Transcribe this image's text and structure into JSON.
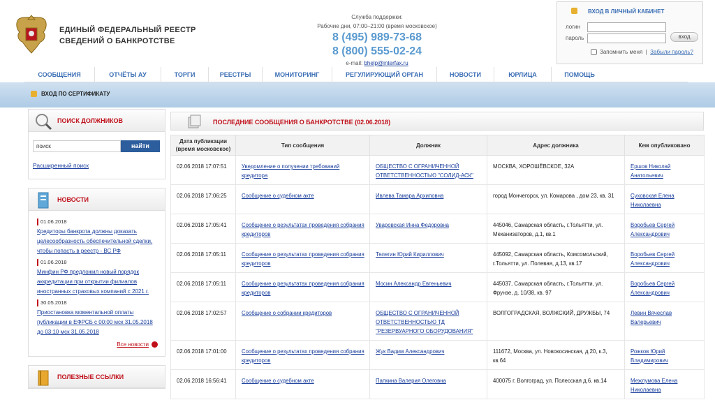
{
  "header": {
    "title_line1": "ЕДИНЫЙ ФЕДЕРАЛЬНЫЙ РЕЕСТР",
    "title_line2": "СВЕДЕНИЙ О БАНКРОТСТВЕ",
    "support_label": "Служба поддержки:",
    "support_hours": "Рабочие дни, 07:00–21:00 (время московское)",
    "phone1": "8 (495) 989-73-68",
    "phone2": "8 (800) 555-02-24",
    "email_label": "e-mail:",
    "email": "bhelp@interfax.ru"
  },
  "login": {
    "title": "ВХОД В ЛИЧНЫЙ КАБИНЕТ",
    "login_label": "логин",
    "password_label": "пароль",
    "button": "вход",
    "remember": "Запомнить меня",
    "forgot": "Забыли пароль?"
  },
  "nav": {
    "items": [
      {
        "label": "СООБЩЕНИЯ"
      },
      {
        "label": "ОТЧЁТЫ АУ"
      },
      {
        "label": "ТОРГИ"
      },
      {
        "label": "РЕЕСТРЫ"
      },
      {
        "label": "МОНИТОРИНГ"
      },
      {
        "label": "РЕГУЛИРУЮЩИЙ ОРГАН"
      },
      {
        "label": "НОВОСТИ"
      },
      {
        "label": "ЮРЛИЦА"
      },
      {
        "label": "ПОМОЩЬ"
      }
    ]
  },
  "cert_login": "ВХОД ПО СЕРТИФИКАТУ",
  "sidebar": {
    "search_title": "ПОИСК ДОЛЖНИКОВ",
    "search_value": "поиск",
    "search_button": "найти",
    "advanced_search": "Расширенный поиск",
    "news_title": "НОВОСТИ",
    "news": [
      {
        "date": "01.06.2018",
        "text": "Кредиторы банкрота должны доказать целесообразность обеспечительной сделки, чтобы попасть в реестр - ВС РФ"
      },
      {
        "date": "01.06.2018",
        "text": "Минфин РФ предложил новый порядок аккредитации при открытии филиалов иностранных страховых компаний с 2021 г."
      },
      {
        "date": "30.05.2018",
        "text": "Приостановка моментальной оплаты публикации в ЕФРСБ с 00:00 мск 31.05.2018 до 03:10 мск 31.05.2018"
      }
    ],
    "all_news": "Все новости",
    "links_title": "ПОЛЕЗНЫЕ ССЫЛКИ"
  },
  "main": {
    "title": "ПОСЛЕДНИЕ СООБЩЕНИЯ О БАНКРОТСТВЕ (02.06.2018)",
    "columns": [
      "Дата публикации (время московское)",
      "Тип сообщения",
      "Должник",
      "Адрес должника",
      "Кем опубликовано"
    ],
    "rows": [
      {
        "date": "02.06.2018 17:07:51",
        "type": "Уведомление о получении требований кредитора",
        "debtor": "ОБЩЕСТВО С ОГРАНИЧЕННОЙ ОТВЕТСТВЕННОСТЬЮ \"СОЛИД-АСК\"",
        "address": "МОСКВА, ХОРОШЁВСКОЕ, 32А",
        "publisher": "Ершов Николай Анатольевич"
      },
      {
        "date": "02.06.2018 17:06:25",
        "type": "Сообщение о судебном акте",
        "debtor": "Ивлева Тамара Архиповна",
        "address": "город Мончегорск, ул. Комарова , дом 23, кв. 31",
        "publisher": "Суховская Елена Николаевна"
      },
      {
        "date": "02.06.2018 17:05:41",
        "type": "Сообщение о результатах проведения собрания кредиторов",
        "debtor": "Уваровская Инна Федоровна",
        "address": "445046, Самарская область, г.Тольятти, ул. Механизаторов, д.1, кв.1",
        "publisher": "Воробьев Сергей Александрович"
      },
      {
        "date": "02.06.2018 17:05:11",
        "type": "Сообщение о результатах проведения собрания кредиторов",
        "debtor": "Телегин Юрий Кириллович",
        "address": "445092, Самарская область, Комсомольский, г.Тольятти, ул. Полевая, д.13, кв.17",
        "publisher": "Воробьев Сергей Александрович"
      },
      {
        "date": "02.06.2018 17:05:11",
        "type": "Сообщение о результатах проведения собрания кредиторов",
        "debtor": "Мосин Александр Евгеньевич",
        "address": "445037, Самарская область, г.Тольятти, ул. Фрунзе, д. 10/38, кв. 97",
        "publisher": "Воробьев Сергей Александрович"
      },
      {
        "date": "02.06.2018 17:02:57",
        "type": "Сообщение о собрании кредиторов",
        "debtor": "ОБЩЕСТВО С ОГРАНИЧЕННОЙ ОТВЕТСТВЕННОСТЬЮ ТД \"РЕЗЕРВУАРНОГО ОБОРУДОВАНИЯ\"",
        "address": "ВОЛГОГРАДСКАЯ, ВОЛЖСКИЙ, ДРУЖБЫ, 74",
        "publisher": "Левин Вячеслав Валерьевич"
      },
      {
        "date": "02.06.2018 17:01:00",
        "type": "Сообщение о результатах проведения собрания кредиторов",
        "debtor": "Жук Вадим Александрович",
        "address": "111672, Москва, ул. Новокосинская, д.20, к.3, кв.64",
        "publisher": "Рожков Юрий Владимирович"
      },
      {
        "date": "02.06.2018 16:56:41",
        "type": "Сообщение о судебном акте",
        "debtor": "Папкина Валерия Олеговна",
        "address": "400075 г. Волгоград, ул. Полесская д.6. кв.14",
        "publisher": "Межлумова Елена Николаевна"
      }
    ]
  },
  "colors": {
    "accent_red": "#c0101a",
    "link_blue": "#1a3f9c",
    "nav_blue": "#3c6fb5",
    "phone_blue": "#5a9ad0"
  }
}
